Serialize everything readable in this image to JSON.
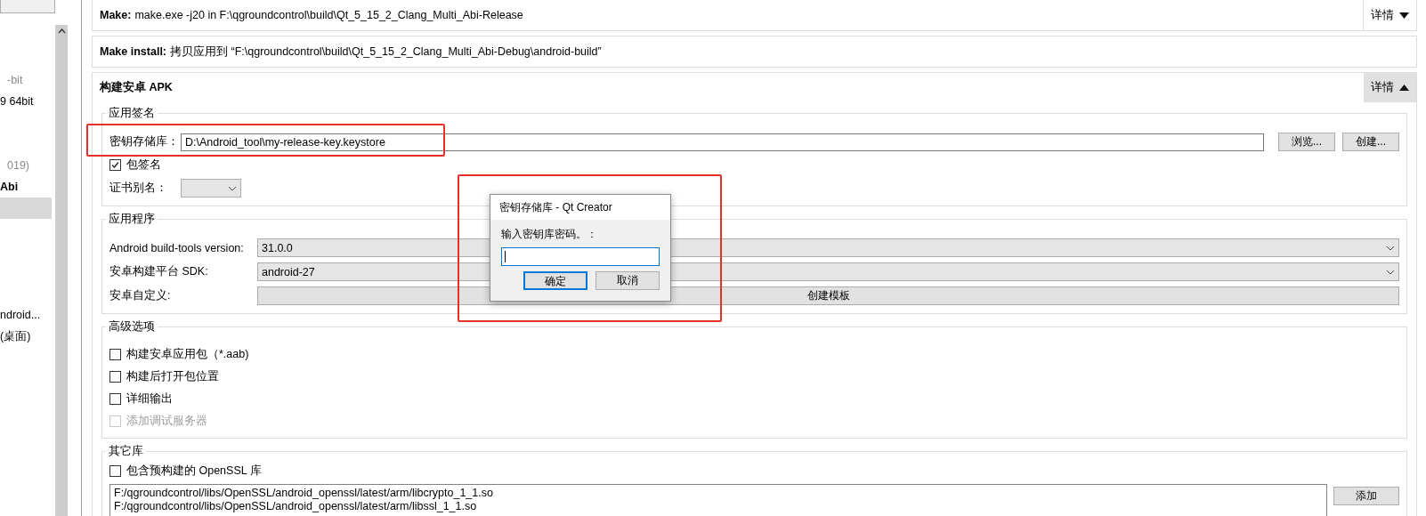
{
  "sidebar": {
    "items": [
      {
        "kind": "muted",
        "text": "-bit",
        "selected": false
      },
      {
        "kind": "normal",
        "text": "9 64bit",
        "selected": false
      },
      {
        "kind": "muted",
        "text": "019)",
        "selected": false
      },
      {
        "kind": "bold",
        "text": "Abi",
        "selected": false
      },
      {
        "kind": "blank",
        "selected": true
      },
      {
        "kind": "normal",
        "text": "ndroid...",
        "selected": false
      },
      {
        "kind": "normal",
        "text": "(桌面)",
        "selected": false
      }
    ]
  },
  "steps": [
    {
      "title": "Make:",
      "text": "make.exe -j20 in F:\\qgroundcontrol\\build\\Qt_5_15_2_Clang_Multi_Abi-Release",
      "details": {
        "label": "详情",
        "expanded": false
      }
    },
    {
      "title": "Make install:",
      "text": "拷贝应用到 “F:\\qgroundcontrol\\build\\Qt_5_15_2_Clang_Multi_Abi-Debug\\android-build”"
    }
  ],
  "apk": {
    "title": "构建安卓 APK",
    "details": {
      "label": "详情",
      "expanded": true
    },
    "signing": {
      "title": "应用签名",
      "keystore_label": "密钥存储库：",
      "keystore_value": "D:\\Android_tool\\my-release-key.keystore",
      "browse": "浏览...",
      "create": "创建...",
      "sign_package": {
        "label": "包签名",
        "checked": true
      },
      "alias_label": "证书别名："
    },
    "application": {
      "title": "应用程序",
      "rows": [
        {
          "label": "Android build-tools version:",
          "kind": "combo",
          "value": "31.0.0"
        },
        {
          "label": "安卓构建平台 SDK:",
          "kind": "combo",
          "value": "android-27"
        },
        {
          "label": "安卓自定义:",
          "kind": "button",
          "value": "创建模板"
        }
      ]
    },
    "advanced": {
      "title": "高级选项",
      "options": [
        {
          "label": "构建安卓应用包（*.aab)",
          "checked": false,
          "disabled": false
        },
        {
          "label": "构建后打开包位置",
          "checked": false,
          "disabled": false
        },
        {
          "label": "详细输出",
          "checked": false,
          "disabled": false
        },
        {
          "label": "添加调试服务器",
          "checked": false,
          "disabled": true
        }
      ]
    },
    "libraries": {
      "title": "其它库",
      "include_openssl": {
        "label": "包含预构建的 OpenSSL 库",
        "checked": false
      },
      "paths": [
        "F:/qgroundcontrol/libs/OpenSSL/android_openssl/latest/arm/libcrypto_1_1.so",
        "F:/qgroundcontrol/libs/OpenSSL/android_openssl/latest/arm/libssl_1_1.so"
      ],
      "add": "添加"
    }
  },
  "dialog": {
    "title": "密钥存储库 - Qt Creator",
    "prompt": "输入密钥库密码。：",
    "ok": "确定",
    "cancel": "取消"
  }
}
